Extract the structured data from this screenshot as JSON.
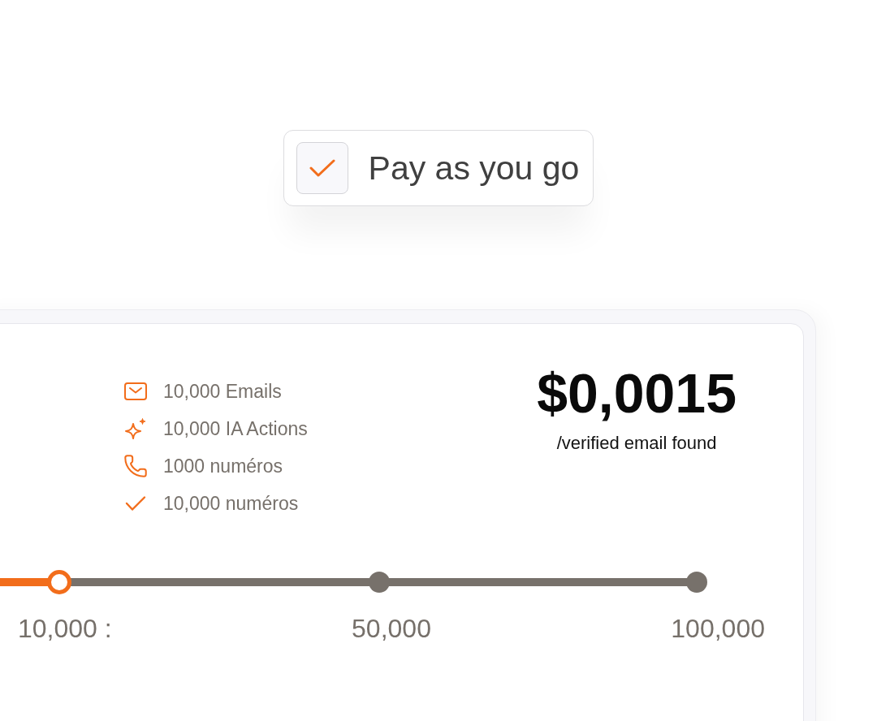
{
  "pay_as_you_go": {
    "label": "Pay as you go",
    "checked": true
  },
  "plan": {
    "features": [
      {
        "kind": "email",
        "label": "10,000 Emails"
      },
      {
        "kind": "ai",
        "label": "10,000 IA Actions"
      },
      {
        "kind": "phone",
        "label": "1000 numéros"
      },
      {
        "kind": "check",
        "label": "10,000 numéros"
      }
    ],
    "price": "$0,0015",
    "price_unit": "/verified email found",
    "slider": {
      "level": 0.1,
      "stops": [
        {
          "label": "10,000 :",
          "selected": true
        },
        {
          "label": "50,000",
          "selected": false
        },
        {
          "label": "100,000",
          "selected": false
        }
      ]
    }
  }
}
